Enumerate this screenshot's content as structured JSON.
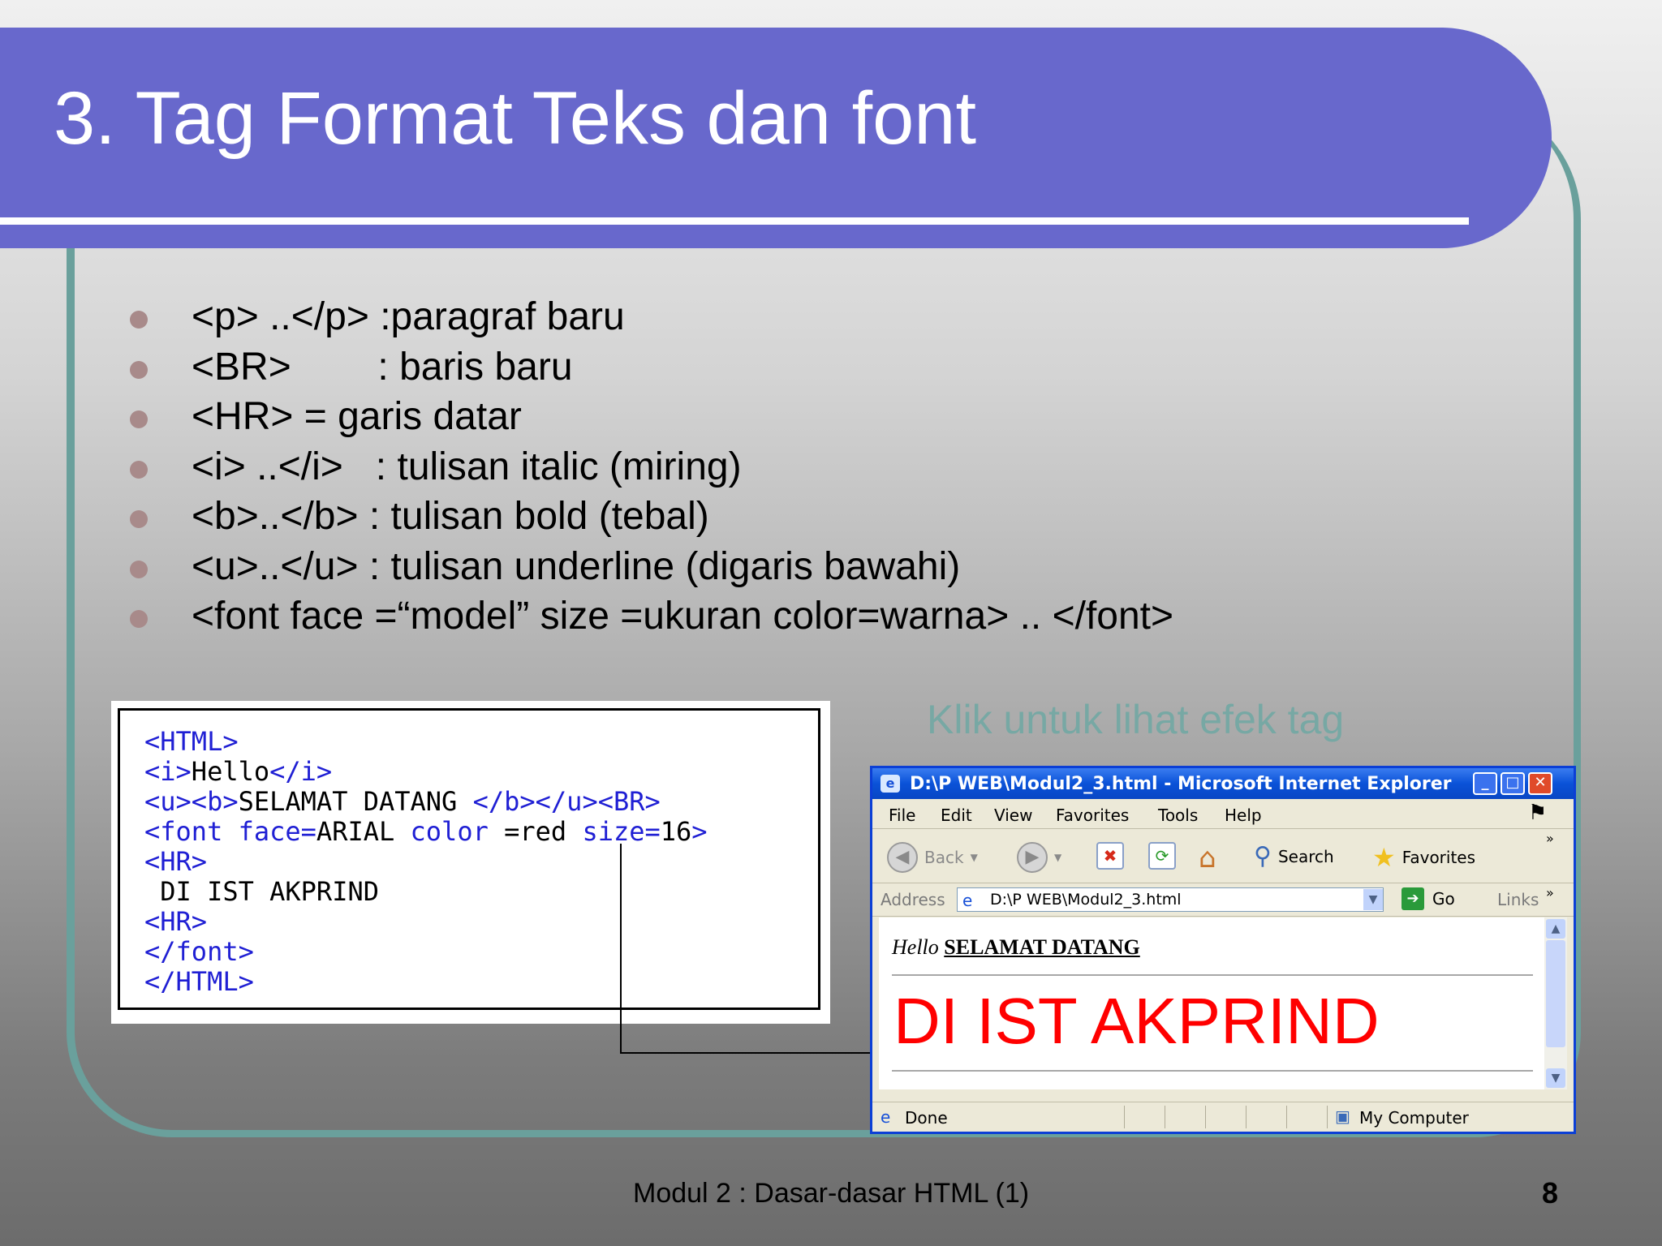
{
  "slide": {
    "title": "3. Tag Format Teks dan font",
    "bullets": [
      "<p> ..</p> :paragraf baru",
      "<BR>        : baris baru",
      "<HR> = garis datar",
      "<i> ..</i>   : tulisan italic (miring)",
      "<b>..</b> : tulisan bold (tebal)",
      "<u>..</u> : tulisan underline (digaris bawahi)",
      "<font face =“model” size =ukuran color=warna> .. </font>"
    ],
    "hint": "Klik untuk lihat efek tag",
    "footer": "Modul 2 : Dasar-dasar HTML (1)",
    "page_number": "8"
  },
  "code": {
    "l1": "<HTML>",
    "l2a": "<i>",
    "l2b": "Hello",
    "l2c": "</i>",
    "l3a": "<u><b>",
    "l3b": "SELAMAT DATANG ",
    "l3c": "</b></u><BR>",
    "l4a": "<font face=",
    "l4b": "ARIAL",
    "l4c": " color ",
    "l4d": "=red ",
    "l4e": "size=",
    "l4f": "16",
    "l4g": ">",
    "l5": "<HR>",
    "l6": " DI IST AKPRIND",
    "l7": "<HR>",
    "l8": "</font>",
    "l9": "</HTML>"
  },
  "browser": {
    "title": "D:\\P WEB\\Modul2_3.html - Microsoft Internet Explorer",
    "menu": [
      "File",
      "Edit",
      "View",
      "Favorites",
      "Tools",
      "Help"
    ],
    "toolbar": {
      "back": "Back",
      "search": "Search",
      "favorites": "Favorites"
    },
    "address_label": "Address",
    "address_value": "D:\\P WEB\\Modul2_3.html",
    "go": "Go",
    "links": "Links",
    "page": {
      "italic": "Hello",
      "underline": "SELAMAT DATANG",
      "big": "DI IST AKPRIND"
    },
    "status_left": "Done",
    "status_right": "My Computer"
  }
}
